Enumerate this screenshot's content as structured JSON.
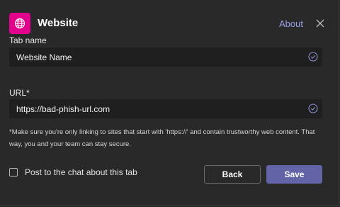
{
  "header": {
    "title": "Website",
    "about_label": "About",
    "app_icon": "globe-icon",
    "close_icon": "close-icon",
    "icon_color": "#e3008c"
  },
  "form": {
    "tab_name_label": "Tab name",
    "tab_name_value": "Website Name",
    "url_label": "URL*",
    "url_value": "https://bad-phish-url.com",
    "valid_icon": "check-circle-icon",
    "note": "*Make sure you're only linking to sites that start with 'https://' and contain trustworthy web content. That way, you and your team can stay secure.",
    "post_to_chat_label": "Post to the chat about this tab",
    "post_to_chat_checked": false
  },
  "actions": {
    "back_label": "Back",
    "save_label": "Save",
    "accent_color": "#6264a7"
  }
}
